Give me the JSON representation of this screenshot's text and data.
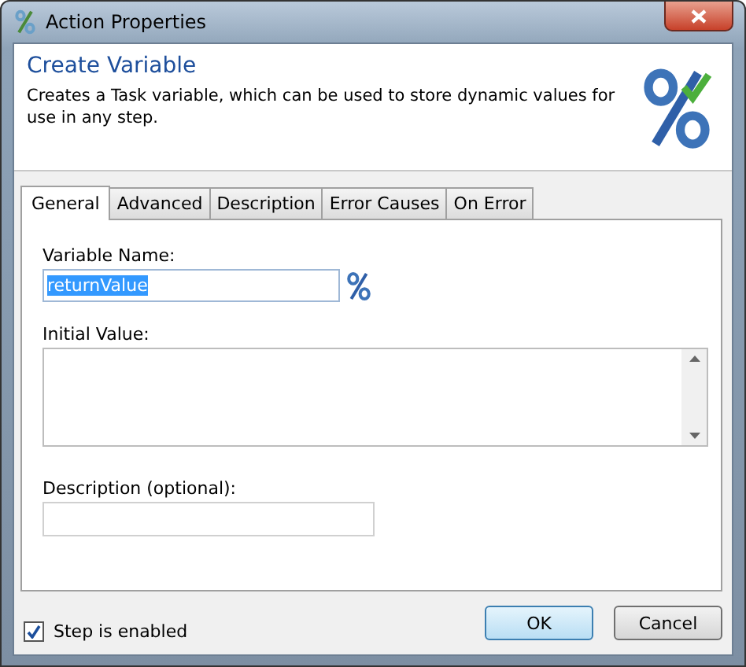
{
  "window": {
    "title": "Action Properties"
  },
  "header": {
    "title": "Create Variable",
    "description": "Creates a Task variable, which can be used to store dynamic values for use in any step."
  },
  "tabs": [
    {
      "label": "General",
      "selected": true
    },
    {
      "label": "Advanced",
      "selected": false
    },
    {
      "label": "Description",
      "selected": false
    },
    {
      "label": "Error Causes",
      "selected": false
    },
    {
      "label": "On Error",
      "selected": false
    }
  ],
  "fields": [
    {
      "kind": "text",
      "label": "Variable Name:",
      "value": "returnValue",
      "value_selected": true,
      "variable_button": true
    },
    {
      "kind": "multiline",
      "label": "Initial Value:"
    },
    {
      "kind": "short",
      "label": "Description (optional):"
    }
  ],
  "step_enabled": {
    "label": "Step is enabled",
    "checked": true
  },
  "buttons": [
    {
      "label": "OK",
      "default": true
    },
    {
      "label": "Cancel",
      "default": false
    }
  ]
}
